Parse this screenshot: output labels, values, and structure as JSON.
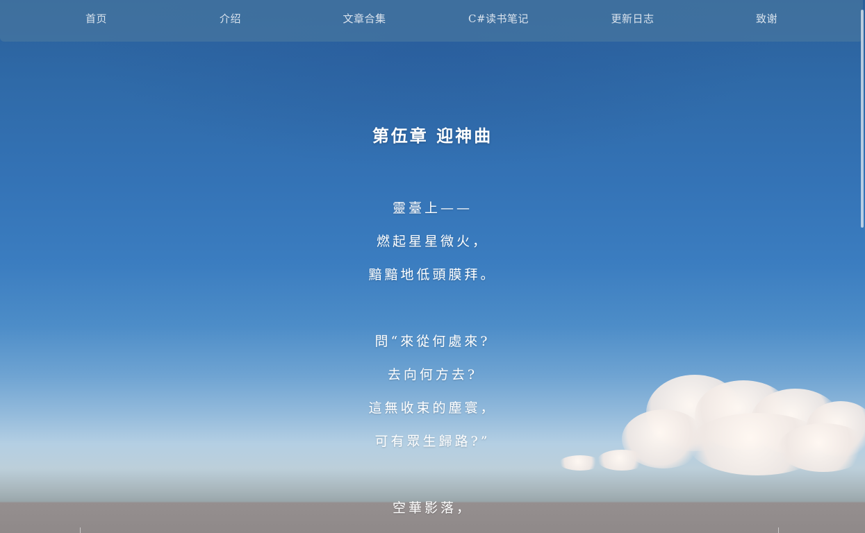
{
  "nav": {
    "items": [
      {
        "label": "首页"
      },
      {
        "label": "介绍"
      },
      {
        "label": "文章合集"
      },
      {
        "label": "C#读书笔记"
      },
      {
        "label": "更新日志"
      },
      {
        "label": "致谢"
      }
    ]
  },
  "article": {
    "title": "第伍章  迎神曲",
    "lines": [
      "靈臺上——",
      "燃起星星微火，",
      "黯黯地低頭膜拜。",
      "問“來從何處來?",
      "去向何方去?",
      "這無收束的塵寰，",
      "可有眾生歸路?”",
      "空華影落，"
    ]
  },
  "colors": {
    "sky_top": "#2a5f9a",
    "sky_horizon": "#b4cfe3",
    "ground": "#928c8c",
    "nav_bg": "#46769f",
    "text": "#ffffff"
  }
}
